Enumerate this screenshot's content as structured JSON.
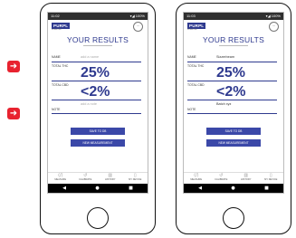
{
  "arrows": [
    "➜",
    "➜"
  ],
  "phones": [
    {
      "status_time": "11:02",
      "status_right": "▾◢ 100%",
      "logo": "PURPL",
      "logo_sub": "SCIENTIFIC",
      "avatar": "···",
      "title": "YOUR RESULTS",
      "name_label": "NAME",
      "name_value": "add a name",
      "thc_label": "TOTAL THC",
      "thc_value": "25%",
      "cbd_label": "TOTAL CBD",
      "cbd_value": "<2%",
      "note_label": "NOTE",
      "note_value": "add a note",
      "save_button": "SAVE TO DB",
      "new_button": "NEW MEASUREMENT",
      "nav": [
        "MEASURE",
        "CALIBRATE",
        "HISTORY",
        "MY DEVICE"
      ]
    },
    {
      "status_time": "11:03",
      "status_right": "▾◢ 100%",
      "logo": "PURPL",
      "logo_sub": "SCIENTIFIC",
      "avatar": "···",
      "title": "YOUR RESULTS",
      "name_label": "NAME",
      "name_value": "Sizzerbeam",
      "thc_label": "TOTAL THC",
      "thc_value": "25%",
      "cbd_label": "TOTAL CBD",
      "cbd_value": "<2%",
      "note_label": "NOTE",
      "note_value": "Batch xyz",
      "save_button": "SAVE TO DB",
      "new_button": "NEW MEASUREMENT",
      "nav": [
        "MEASURE",
        "CALIBRATE",
        "HISTORY",
        "MY DEVICE"
      ]
    }
  ],
  "sysnav": [
    "◀",
    "●",
    "■"
  ]
}
